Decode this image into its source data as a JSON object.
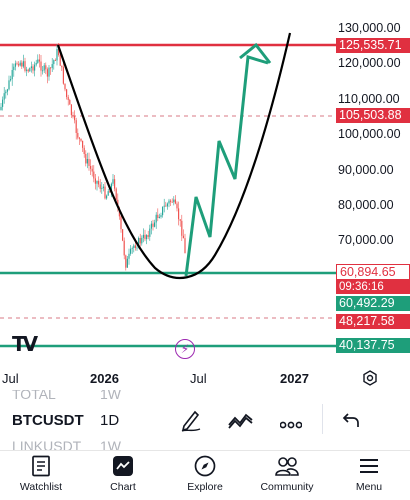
{
  "symbol": "BTCUSDT",
  "interval": "1D",
  "prev_symbol": "TOTAL",
  "prev_interval": "1W",
  "next_symbol": "LINKUSDT",
  "next_interval": "1W",
  "price_axis": [
    "130,000.00",
    "120,000.00",
    "110,000.00",
    "100,000.00",
    "90,000.00",
    "80,000.00",
    "70,000.00"
  ],
  "price_labels": {
    "top_resistance": "125,535.71",
    "mid_level": "105,503.88",
    "current_price": "60,894.65",
    "countdown": "09:36:16",
    "support_level": "60,492.29",
    "dashed_level": "48,217.58",
    "bottom_level": "40,137.75"
  },
  "time_axis": [
    "Jul",
    "2026",
    "Jul",
    "2027"
  ],
  "logo_text": "TV",
  "colors": {
    "red": "#e03040",
    "green": "#1e9e7a",
    "dashed_red": "#d97a86",
    "purple": "#9c27b0",
    "candle_up": "#26a69a",
    "candle_down": "#ef5350"
  },
  "nav": {
    "watchlist": "Watchlist",
    "chart": "Chart",
    "explore": "Explore",
    "community": "Community",
    "menu": "Menu"
  },
  "icons": [
    "settings-icon",
    "pencil-icon",
    "indicators-icon",
    "more-icon",
    "undo-icon",
    "lightning-icon"
  ]
}
